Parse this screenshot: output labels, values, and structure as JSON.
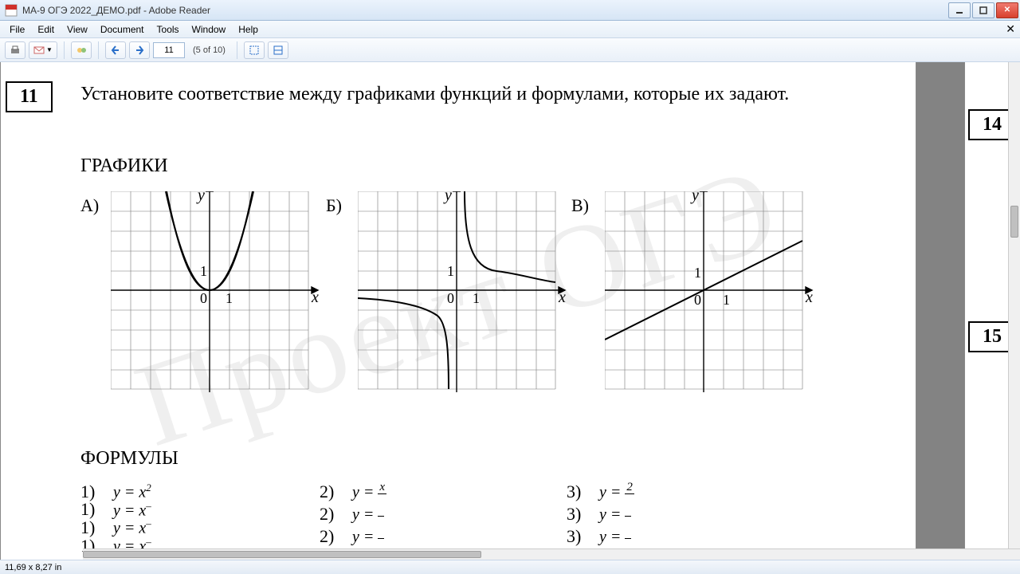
{
  "window": {
    "title": "МА-9 ОГЭ 2022_ДЕМО.pdf - Adobe Reader"
  },
  "menu": {
    "file": "File",
    "edit": "Edit",
    "view": "View",
    "document": "Document",
    "tools": "Tools",
    "window": "Window",
    "help": "Help"
  },
  "toolbar": {
    "page_current": "11",
    "page_count": "(5 of 10)"
  },
  "status": {
    "dimensions": "11,69 x 8,27 in"
  },
  "exam": {
    "qnum_left": "11",
    "qnum_r1": "14",
    "qnum_r2": "15",
    "question": "Установите соответствие между графиками функций и формулами, которые их задают.",
    "graphs_h": "ГРАФИКИ",
    "formulas_h": "ФОРМУЛЫ",
    "labels": {
      "a": "А)",
      "b": "Б)",
      "v": "В)"
    },
    "axis": {
      "x": "x",
      "y": "y",
      "zero": "0",
      "one": "1"
    },
    "formulas": {
      "n1": "1)",
      "n2": "2)",
      "n3": "3)",
      "f1": "y = x",
      "f1sup": "2",
      "f2_num": "x",
      "f2_den": "",
      "f2_pre": "y = ",
      "f3_num": "2",
      "f3_den": "",
      "f3_pre": "y = ",
      "rep": "y = x"
    },
    "watermark": "Проект ОГЭ"
  },
  "chart_data": [
    {
      "type": "line",
      "label": "А",
      "function": "y = x^2",
      "xlim": [
        -5,
        5
      ],
      "ylim": [
        -5,
        5
      ],
      "series": [
        {
          "name": "parabola",
          "points": [
            [
              -2.2,
              4.8
            ],
            [
              -2,
              4
            ],
            [
              -1,
              1
            ],
            [
              0,
              0
            ],
            [
              1,
              1
            ],
            [
              2,
              4
            ],
            [
              2.2,
              4.8
            ]
          ]
        }
      ]
    },
    {
      "type": "line",
      "label": "Б",
      "function": "y = 2/x",
      "xlim": [
        -5,
        5
      ],
      "ylim": [
        -5,
        5
      ],
      "series": [
        {
          "name": "hyperbola-pos",
          "points": [
            [
              0.4,
              5
            ],
            [
              0.5,
              4
            ],
            [
              1,
              2
            ],
            [
              2,
              1
            ],
            [
              4,
              0.5
            ],
            [
              5,
              0.4
            ]
          ]
        },
        {
          "name": "hyperbola-neg",
          "points": [
            [
              -5,
              -0.4
            ],
            [
              -4,
              -0.5
            ],
            [
              -2,
              -1
            ],
            [
              -1,
              -2
            ],
            [
              -0.5,
              -4
            ],
            [
              -0.4,
              -5
            ]
          ]
        }
      ]
    },
    {
      "type": "line",
      "label": "В",
      "function": "y = x/2",
      "xlim": [
        -5,
        5
      ],
      "ylim": [
        -5,
        5
      ],
      "series": [
        {
          "name": "line",
          "points": [
            [
              -5,
              -2.5
            ],
            [
              5,
              2.5
            ]
          ]
        }
      ]
    }
  ]
}
